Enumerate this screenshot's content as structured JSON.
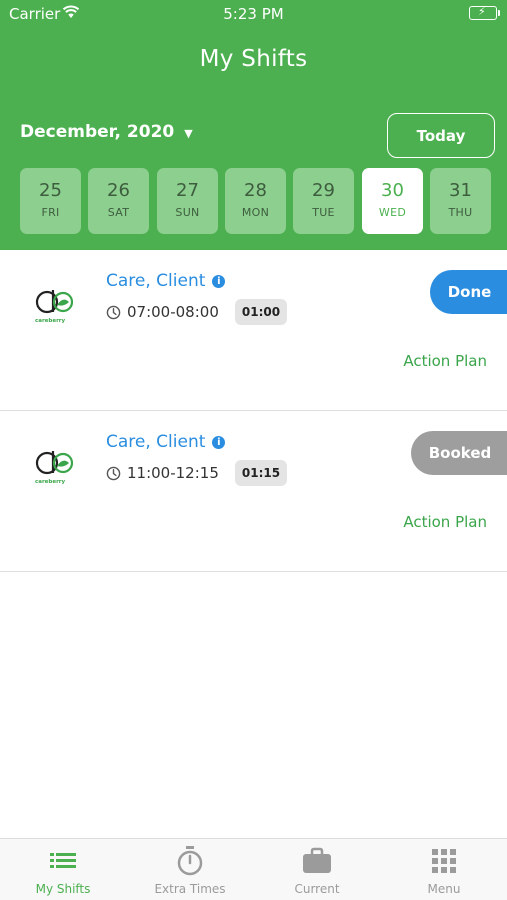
{
  "status_bar": {
    "carrier": "Carrier",
    "time": "5:23 PM"
  },
  "header": {
    "title": "My Shifts",
    "month_label": "December, 2020",
    "today_label": "Today"
  },
  "days": [
    {
      "num": "25",
      "weekday": "FRI"
    },
    {
      "num": "26",
      "weekday": "SAT"
    },
    {
      "num": "27",
      "weekday": "SUN"
    },
    {
      "num": "28",
      "weekday": "MON"
    },
    {
      "num": "29",
      "weekday": "TUE"
    },
    {
      "num": "30",
      "weekday": "WED",
      "selected": true
    },
    {
      "num": "31",
      "weekday": "THU"
    }
  ],
  "shifts": [
    {
      "client": "Care, Client",
      "time_range": "07:00-08:00",
      "duration": "01:00",
      "status": "Done",
      "action": "Action Plan"
    },
    {
      "client": "Care, Client",
      "time_range": "11:00-12:15",
      "duration": "01:15",
      "status": "Booked",
      "action": "Action Plan"
    }
  ],
  "logo_text": "careberry",
  "tabbar": [
    {
      "label": "My Shifts",
      "icon": "list-icon",
      "active": true
    },
    {
      "label": "Extra Times",
      "icon": "stopwatch-icon"
    },
    {
      "label": "Current",
      "icon": "briefcase-icon"
    },
    {
      "label": "Menu",
      "icon": "grid-icon"
    }
  ],
  "colors": {
    "primary_green": "#4cb050",
    "done_blue": "#2a8de0",
    "booked_gray": "#9e9e9e",
    "action_green": "#3aa54a"
  }
}
